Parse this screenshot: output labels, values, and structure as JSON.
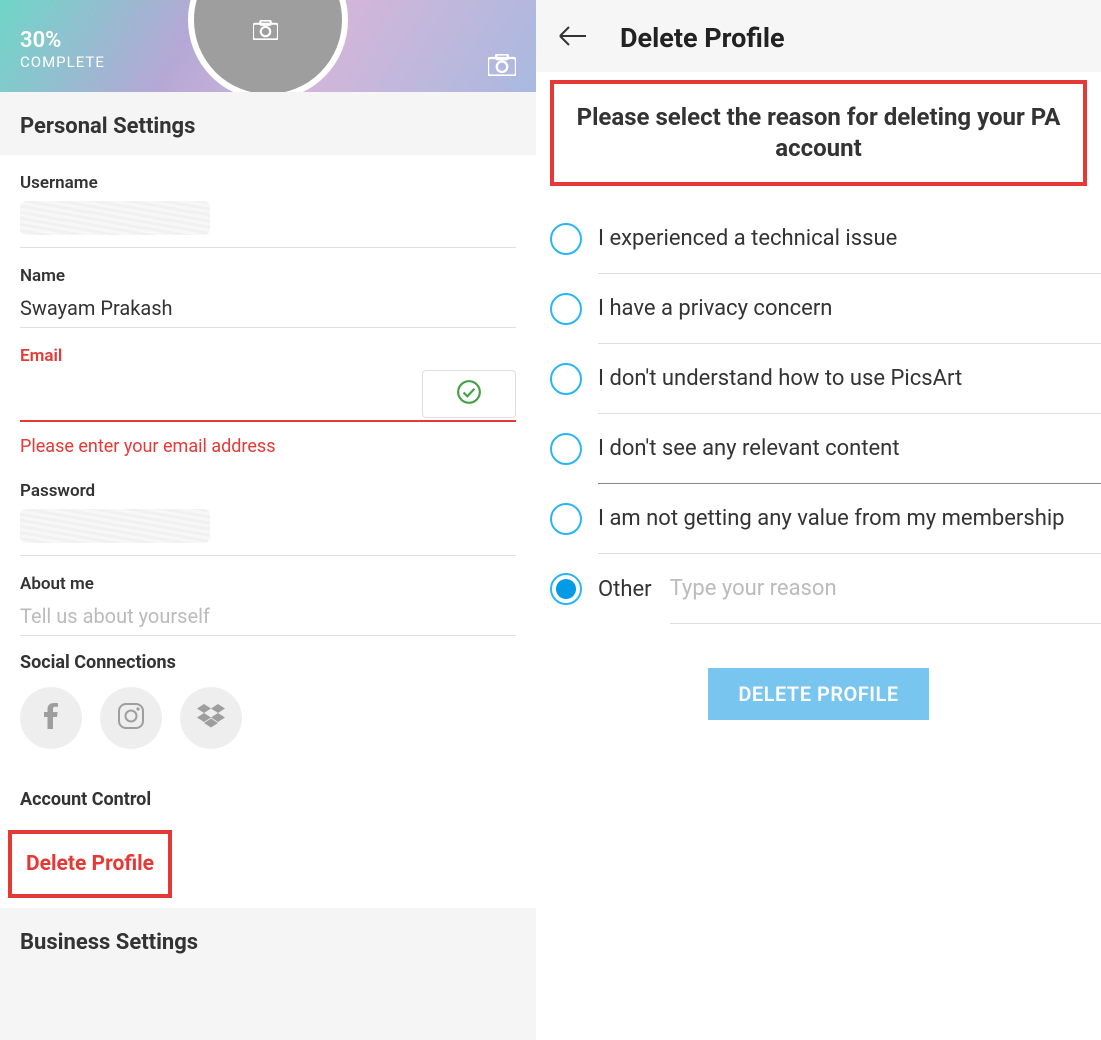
{
  "left": {
    "progress": {
      "percent": "30%",
      "label": "COMPLETE"
    },
    "section_heading": "Personal Settings",
    "username_label": "Username",
    "name_label": "Name",
    "name_value": "Swayam Prakash",
    "email_label": "Email",
    "email_error": "Please enter your email address",
    "password_label": "Password",
    "about_label": "About me",
    "about_placeholder": "Tell us about yourself",
    "social_label": "Social Connections",
    "account_control_label": "Account Control",
    "delete_profile_label": "Delete Profile",
    "business_settings_label": "Business Settings"
  },
  "right": {
    "title": "Delete Profile",
    "instruction": "Please select the reason for deleting your PA account",
    "reasons": [
      "I experienced a technical issue",
      "I have a privacy concern",
      "I don't understand how to use PicsArt",
      "I don't see any relevant content",
      "I am not getting any value from my membership"
    ],
    "other_label": "Other",
    "other_placeholder": "Type your reason",
    "delete_button": "DELETE PROFILE"
  }
}
